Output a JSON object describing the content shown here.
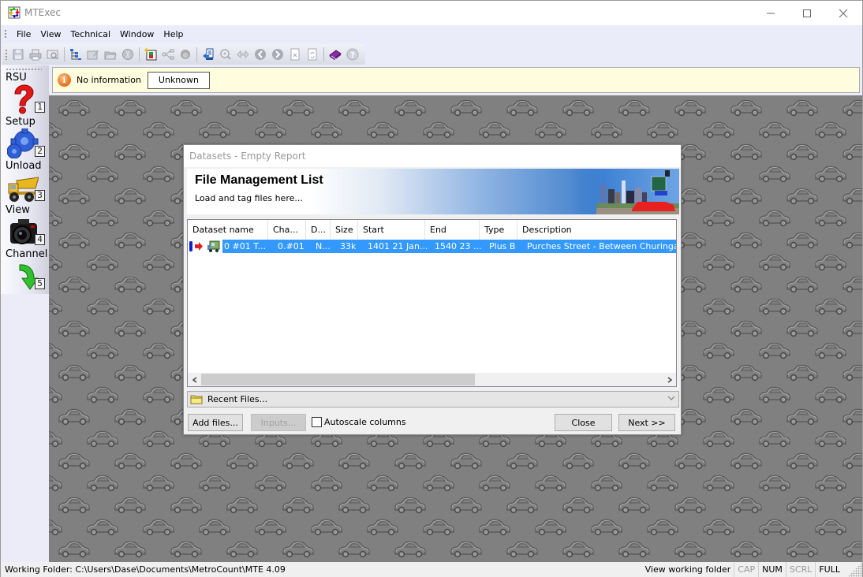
{
  "window": {
    "title": "MTExec",
    "controls": {
      "minimize": "minimize",
      "maximize": "maximize",
      "close": "close"
    }
  },
  "menubar": {
    "items": [
      "File",
      "View",
      "Technical",
      "Window",
      "Help"
    ]
  },
  "toolbar": {
    "buttons": [
      {
        "icon": "save-icon",
        "enabled": false
      },
      {
        "icon": "print-icon",
        "enabled": false
      },
      {
        "icon": "print-preview-icon",
        "enabled": false
      },
      {
        "sep": true
      },
      {
        "icon": "tree-view-icon",
        "enabled": true
      },
      {
        "icon": "edit-icon",
        "enabled": false
      },
      {
        "icon": "open-folder-icon",
        "enabled": false
      },
      {
        "icon": "sensor-icon",
        "enabled": false
      },
      {
        "sep": true
      },
      {
        "icon": "new-report-icon",
        "enabled": true
      },
      {
        "icon": "share-icon",
        "enabled": false
      },
      {
        "icon": "person-icon",
        "enabled": false
      },
      {
        "sep": true
      },
      {
        "icon": "import-icon",
        "enabled": true
      },
      {
        "icon": "zoom-in-icon",
        "enabled": false
      },
      {
        "icon": "fit-width-icon",
        "enabled": false
      },
      {
        "icon": "back-icon",
        "enabled": false
      },
      {
        "icon": "forward-icon",
        "enabled": false
      },
      {
        "icon": "close-doc-icon",
        "enabled": false
      },
      {
        "icon": "refresh-doc-icon",
        "enabled": false
      },
      {
        "sep": true
      },
      {
        "icon": "book-icon",
        "enabled": true
      },
      {
        "icon": "help-icon",
        "enabled": false
      }
    ]
  },
  "nav": {
    "items": [
      {
        "label": "RSU",
        "number": "1",
        "icon": "question-icon"
      },
      {
        "label": "Setup",
        "number": "2",
        "icon": "gear-icon"
      },
      {
        "label": "Unload",
        "number": "3",
        "icon": "dump-truck-icon"
      },
      {
        "label": "View",
        "number": "4",
        "icon": "camera-icon"
      },
      {
        "label": "Channel",
        "number": "5",
        "icon": "arrow-down-icon"
      }
    ]
  },
  "infobar": {
    "message": "No information",
    "button_label": "Unknown"
  },
  "dialog": {
    "title": "Datasets - Empty Report",
    "banner_title": "File Management List",
    "banner_subtitle": "Load and tag files here...",
    "columns": [
      "Dataset name",
      "Cha...",
      "D...",
      "Size",
      "Start",
      "End",
      "Type",
      "Description"
    ],
    "rows": [
      {
        "selected": true,
        "dataset_name": "0 #01 T...",
        "channel": "0.#01",
        "d": "N...",
        "size": "33k",
        "start": "1401 21 Jan...",
        "end": "1540 23 ...",
        "type": "Plus B",
        "description": "Purches Street - Between Churinga Street"
      }
    ],
    "recent_files_label": "Recent Files...",
    "add_files_label": "Add files...",
    "inputs_label": "Inputs...",
    "autoscale_label": "Autoscale columns",
    "autoscale_checked": false,
    "close_label": "Close",
    "next_label": "Next >>",
    "colors": {
      "selection": "#3399ff"
    }
  },
  "statusbar": {
    "working_folder": "Working Folder: C:\\Users\\Dase\\Documents\\MetroCount\\MTE 4.09",
    "view_working_folder": "View working folder",
    "cap": "CAP",
    "num": "NUM",
    "scrl": "SCRL",
    "full": "FULL"
  }
}
